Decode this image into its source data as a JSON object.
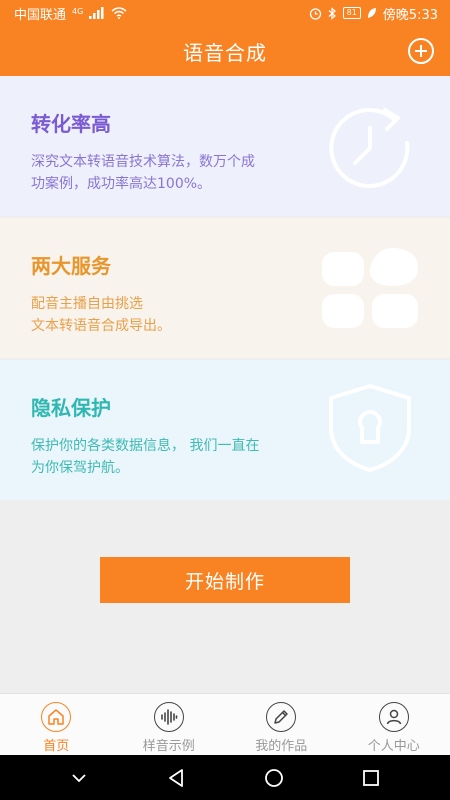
{
  "status_bar": {
    "carrier": "中国联通",
    "network": "4G",
    "battery": "81",
    "time": "傍晚5:33"
  },
  "header": {
    "title": "语音合成"
  },
  "cards": [
    {
      "title": "转化率高",
      "desc_lines": [
        "深究文本转语音技术算法，数万个成",
        "功案例，成功率高达100%。"
      ]
    },
    {
      "title": "两大服务",
      "desc_lines": [
        "配音主播自由挑选",
        "文本转语音合成导出。"
      ]
    },
    {
      "title": "隐私保护",
      "desc_lines": [
        "保护你的各类数据信息， 我们一直在",
        "为你保驾护航。"
      ]
    }
  ],
  "start_button": {
    "label": "开始制作"
  },
  "tabs": [
    {
      "label": "首页",
      "icon": "home-icon",
      "active": true
    },
    {
      "label": "样音示例",
      "icon": "waveform-icon",
      "active": false
    },
    {
      "label": "我的作品",
      "icon": "pencil-icon",
      "active": false
    },
    {
      "label": "个人中心",
      "icon": "user-icon",
      "active": false
    }
  ],
  "colors": {
    "primary": "#f98322",
    "card1_accent": "#7a5bd3",
    "card2_accent": "#e8962c",
    "card3_accent": "#2fb7b2"
  }
}
